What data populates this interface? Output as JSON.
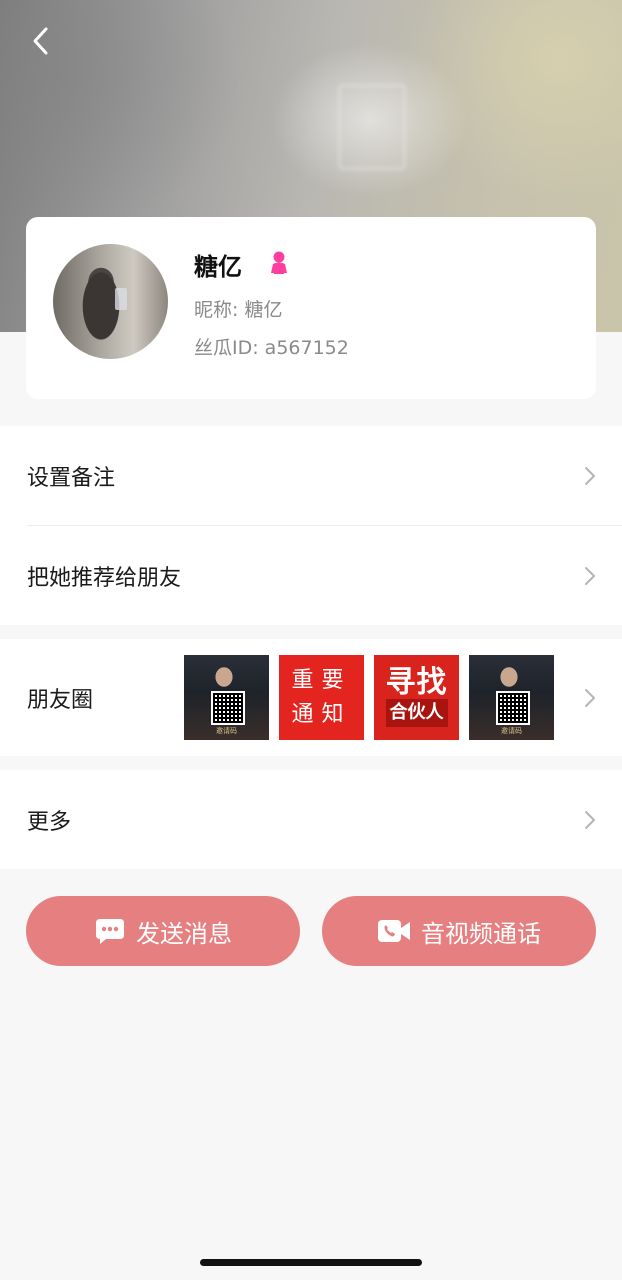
{
  "profile": {
    "name": "糖亿",
    "nickname": "昵称: 糖亿",
    "user_id": "丝瓜ID: a567152",
    "gender_icon": "female-icon",
    "gender_color": "#ff3fa0"
  },
  "menu": {
    "set_remark": "设置备注",
    "recommend": "把她推荐给朋友",
    "moments": "朋友圈",
    "more": "更多"
  },
  "moments_thumbs": {
    "thumb1_caption": "邀请码",
    "thumb2_text": "重要通知",
    "thumb3_line1": "寻找",
    "thumb3_line2": "合伙人",
    "thumb4_caption": "邀请码"
  },
  "actions": {
    "send_message": "发送消息",
    "video_call": "音视频通话"
  },
  "colors": {
    "accent": "#e57f80",
    "background": "#f7f7f7"
  }
}
